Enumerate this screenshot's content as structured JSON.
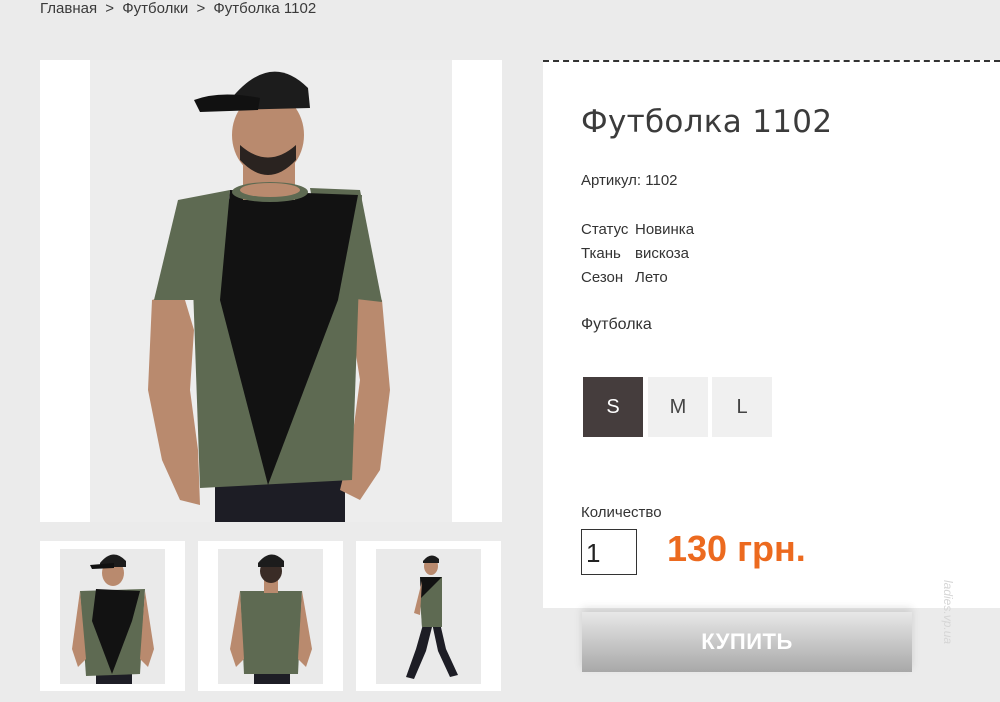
{
  "breadcrumb": {
    "home": "Главная",
    "category": "Футболки",
    "current": "Футболка 1102",
    "separator": ">"
  },
  "product": {
    "title": "Футболка 1102",
    "sku": "Артикул: 1102",
    "properties": [
      {
        "key": "Статус",
        "value": "Новинка"
      },
      {
        "key": "Ткань",
        "value": "вискоза"
      },
      {
        "key": "Сезон",
        "value": "Лето"
      }
    ],
    "category_label": "Футболка",
    "sizes": [
      "S",
      "M",
      "L"
    ],
    "selected_size": "S",
    "quantity_label": "Количество",
    "quantity": "1",
    "price": "130 грн.",
    "buy_label": "КУПИТЬ"
  },
  "colors": {
    "accent": "#ec6a1f",
    "size_active": "#453d3d",
    "shirt_black": "#121212",
    "shirt_green": "#5e6a52"
  },
  "watermark": "ladies.vp.ua"
}
